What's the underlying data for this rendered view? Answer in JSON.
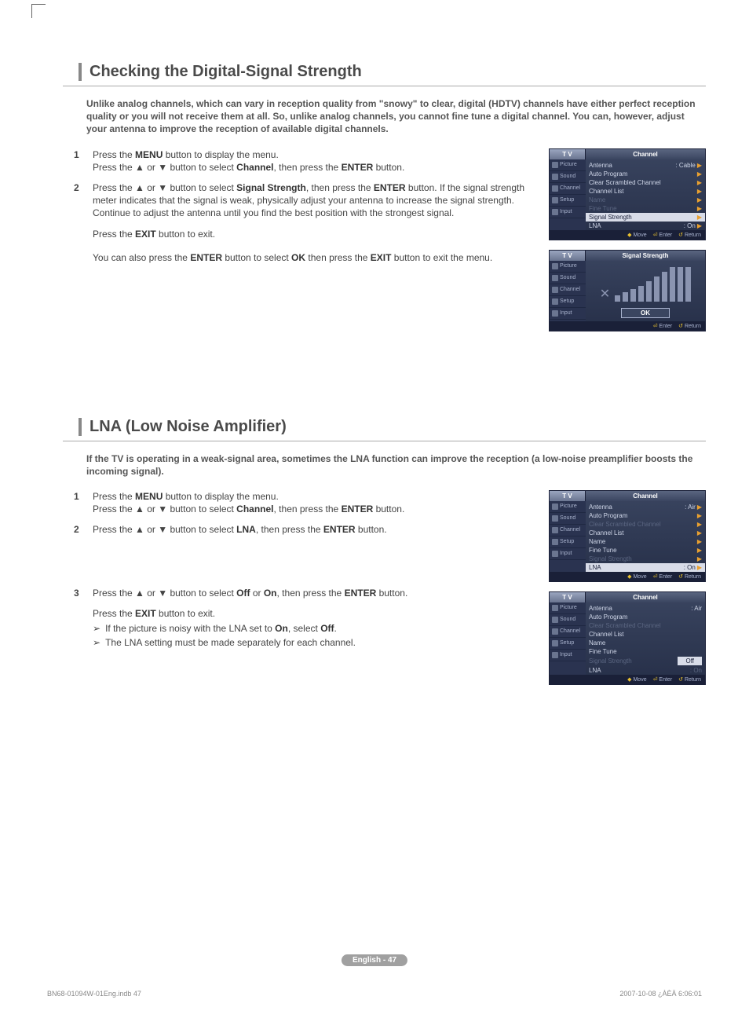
{
  "section1": {
    "title": "Checking the Digital-Signal Strength",
    "intro": "Unlike analog channels, which can vary in reception quality from \"snowy\" to clear, digital (HDTV) channels have either perfect reception quality or you will not receive them at all. So, unlike analog channels, you cannot fine tune a digital channel. You can, however, adjust your antenna to improve the reception of available digital channels.",
    "steps": {
      "s1a": "Press the ",
      "s1_menu": "MENU",
      "s1b": " button to display the menu.",
      "s1c": "Press the ▲ or ▼ button to select ",
      "s1_channel": "Channel",
      "s1d": ", then press the ",
      "s1_enter": "ENTER",
      "s1e": " button.",
      "s2a": "Press the ▲ or ▼ button to select ",
      "s2_ss": "Signal Strength",
      "s2b": ", then press the ",
      "s2_enter": "ENTER",
      "s2c": " button. If the signal strength meter indicates that the signal is weak, physically adjust your antenna to increase the signal strength.",
      "s2d": "Continue to adjust the antenna until you find the best position with the strongest signal.",
      "n1a": "Press the ",
      "n1_exit": "EXIT",
      "n1b": " button to exit.",
      "n2a": "You can also press the ",
      "n2_enter": "ENTER",
      "n2b": " button to select ",
      "n2_ok": "OK",
      "n2c": " then press the ",
      "n2_exit": "EXIT",
      "n2d": " button to exit the menu."
    }
  },
  "section2": {
    "title": "LNA (Low Noise Amplifier)",
    "intro": "If the TV is operating in a weak-signal area, sometimes the LNA function can improve the reception (a low-noise preamplifier boosts the incoming signal).",
    "steps": {
      "s1a": "Press the ",
      "s1_menu": "MENU",
      "s1b": " button to display the menu.",
      "s1c": "Press the ▲ or ▼ button to select ",
      "s1_channel": "Channel",
      "s1d": ", then press the ",
      "s1_enter": "ENTER",
      "s1e": " button.",
      "s2a": "Press the ▲ or ▼ button to select ",
      "s2_lna": "LNA",
      "s2b": ", then press the ",
      "s2_enter": "ENTER",
      "s2c": " button.",
      "s3a": "Press the ▲ or ▼ button to select ",
      "s3_off": "Off",
      "s3_or": " or ",
      "s3_on": "On",
      "s3b": ", then press the ",
      "s3_enter": "ENTER",
      "s3c": " button.",
      "n1a": "Press the ",
      "n1_exit": "EXIT",
      "n1b": " button to exit.",
      "b1a": "If the picture is noisy with the LNA set to ",
      "b1_on": "On",
      "b1b": ", select ",
      "b1_off": "Off",
      "b1c": ".",
      "b2": "The LNA setting must be made separately for each channel."
    }
  },
  "osd": {
    "tv": "T V",
    "title_channel": "Channel",
    "title_signal": "Signal Strength",
    "side": [
      "Picture",
      "Sound",
      "Channel",
      "Setup",
      "Input"
    ],
    "rows": {
      "antenna": "Antenna",
      "cable": ": Cable",
      "air": ": Air",
      "auto": "Auto Program",
      "clear": "Clear Scrambled Channel",
      "clist": "Channel List",
      "name": "Name",
      "fine": "Fine Tune",
      "ss": "Signal Strength",
      "lna": "LNA",
      "on": ": On",
      "off_pill": "Off",
      "on_dim": ": On"
    },
    "foot": {
      "move": "Move",
      "enter": "Enter",
      "return": "Return"
    },
    "ok": "OK"
  },
  "pagebadge": "English - 47",
  "footleft": "BN68-01094W-01Eng.indb   47",
  "footright": "2007-10-08   ¿ÀÈÄ 6:06:01"
}
